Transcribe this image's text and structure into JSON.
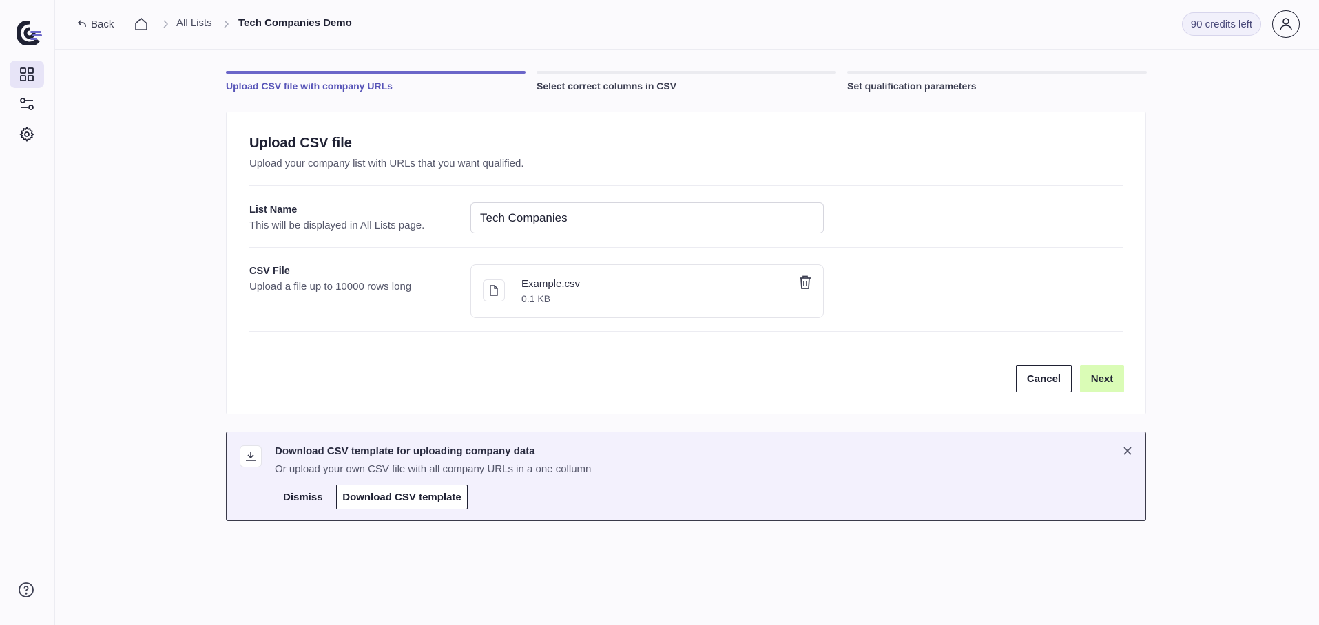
{
  "sidebar": {
    "items": [
      {
        "name": "dashboard",
        "icon": "grid-icon",
        "active": true
      },
      {
        "name": "filters",
        "icon": "sliders-icon",
        "active": false
      },
      {
        "name": "settings",
        "icon": "gear-icon",
        "active": false
      }
    ],
    "help_icon": "help-circle-icon"
  },
  "header": {
    "back_label": "Back",
    "breadcrumb": {
      "home_icon": "home-icon",
      "items": [
        "All Lists",
        "Tech Companies Demo"
      ]
    },
    "credits": "90 credits left",
    "avatar_icon": "user-icon"
  },
  "steps": [
    {
      "label": "Upload CSV file with company URLs",
      "active": true
    },
    {
      "label": "Select correct columns in CSV",
      "active": false
    },
    {
      "label": "Set qualification parameters",
      "active": false
    }
  ],
  "form": {
    "title": "Upload CSV file",
    "subtitle": "Upload your company list with URLs that you want qualified.",
    "list_name": {
      "label": "List Name",
      "help": "This will be displayed in All Lists page.",
      "value": "Tech Companies"
    },
    "csv_file": {
      "label": "CSV File",
      "help": "Upload a file up to 10000 rows long",
      "file_name": "Example.csv",
      "file_size": "0.1 KB"
    },
    "cancel_label": "Cancel",
    "next_label": "Next"
  },
  "banner": {
    "title": "Download CSV template for uploading company data",
    "subtitle": "Or upload your own CSV file with all company URLs in a one collumn",
    "dismiss_label": "Dismiss",
    "download_label": "Download CSV template"
  },
  "colors": {
    "accent": "#6b66c9",
    "next_button": "#dafcb6",
    "banner_bg": "#f3f1fd"
  }
}
